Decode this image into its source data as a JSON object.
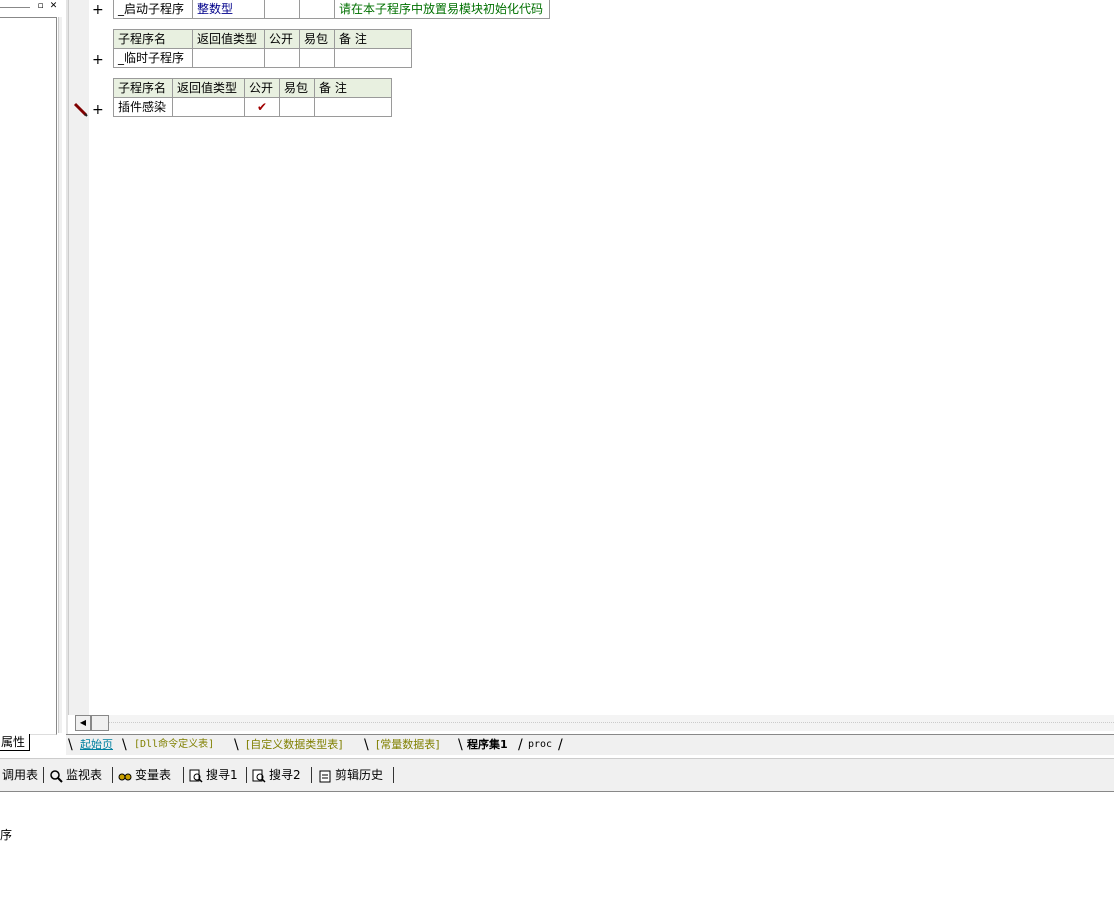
{
  "left_panel": {
    "tab_label": "属性",
    "restore_glyph": "▫",
    "close_glyph": "✕"
  },
  "tables": [
    {
      "rows": [
        [
          "_启动子程序",
          "整数型",
          "",
          "",
          "请在本子程序中放置易模块初始化代码"
        ]
      ]
    },
    {
      "headers": [
        "子程序名",
        "返回值类型",
        "公开",
        "易包",
        "备 注"
      ],
      "rows": [
        [
          "_临时子程序",
          "",
          "",
          "",
          ""
        ]
      ]
    },
    {
      "headers": [
        "子程序名",
        "返回值类型",
        "公开",
        "易包",
        "备 注"
      ],
      "rows": [
        [
          "插件感染",
          "",
          "✔",
          "",
          ""
        ]
      ]
    }
  ],
  "gutter": {
    "plus": "+"
  },
  "tabs": [
    {
      "label": "起始页",
      "color": "#0080a0"
    },
    {
      "label": "[Dll命令定义表]",
      "color": "#808000"
    },
    {
      "label": "[自定义数据类型表]",
      "color": "#808000"
    },
    {
      "label": "[常量数据表]",
      "color": "#808000"
    },
    {
      "label": "程序集1",
      "color": "#000000"
    },
    {
      "label": "proc",
      "color": "#000000"
    }
  ],
  "bottom_toolbar": {
    "items": [
      "调用表",
      "监视表",
      "变量表",
      "搜寻1",
      "搜寻2",
      "剪辑历史"
    ]
  },
  "output": {
    "text": "序"
  },
  "colors": {
    "green_note": "#007000",
    "navy_type": "#00008b",
    "header_bg": "#e8f0e0"
  }
}
